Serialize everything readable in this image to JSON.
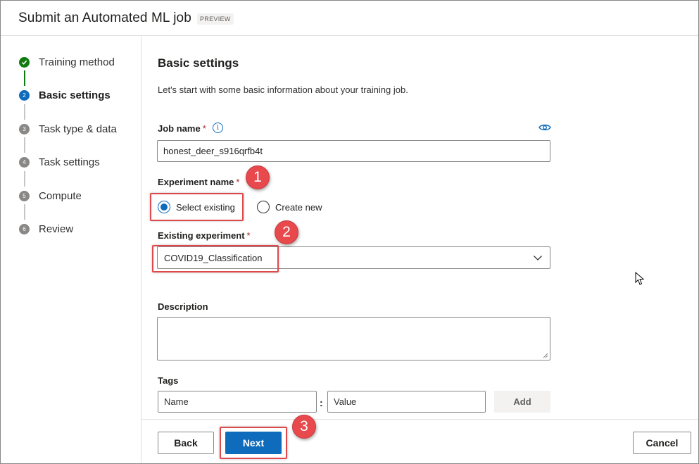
{
  "header": {
    "title": "Submit an Automated ML job",
    "badge": "PREVIEW"
  },
  "steps": [
    {
      "number": "",
      "label": "Training method",
      "state": "done"
    },
    {
      "number": "2",
      "label": "Basic settings",
      "state": "current"
    },
    {
      "number": "3",
      "label": "Task type & data",
      "state": "upcoming"
    },
    {
      "number": "4",
      "label": "Task settings",
      "state": "upcoming"
    },
    {
      "number": "5",
      "label": "Compute",
      "state": "upcoming"
    },
    {
      "number": "6",
      "label": "Review",
      "state": "upcoming"
    }
  ],
  "main": {
    "section_title": "Basic settings",
    "intro": "Let's start with some basic information about your training job.",
    "job_name": {
      "label": "Job name",
      "required_mark": "*",
      "value": "honest_deer_s916qrfb4t"
    },
    "experiment_name": {
      "label": "Experiment name",
      "required_mark": "*",
      "options": [
        "Select existing",
        "Create new"
      ],
      "selected": "Select existing"
    },
    "existing_experiment": {
      "label": "Existing experiment",
      "required_mark": "*",
      "value": "COVID19_Classification"
    },
    "description": {
      "label": "Description",
      "value": ""
    },
    "tags": {
      "label": "Tags",
      "name_placeholder": "Name",
      "value_placeholder": "Value",
      "separator": ":",
      "add_label": "Add"
    }
  },
  "footer": {
    "back_label": "Back",
    "next_label": "Next",
    "cancel_label": "Cancel"
  },
  "annotations": [
    "1",
    "2",
    "3"
  ],
  "colors": {
    "primary": "#0f6cbd",
    "success": "#107c10",
    "callout": "#e8494c",
    "required": "#a4262c"
  },
  "icons": [
    "check-icon",
    "info-icon",
    "eye-icon",
    "chevron-down-icon",
    "resize-grip-icon",
    "mouse-cursor-icon"
  ]
}
